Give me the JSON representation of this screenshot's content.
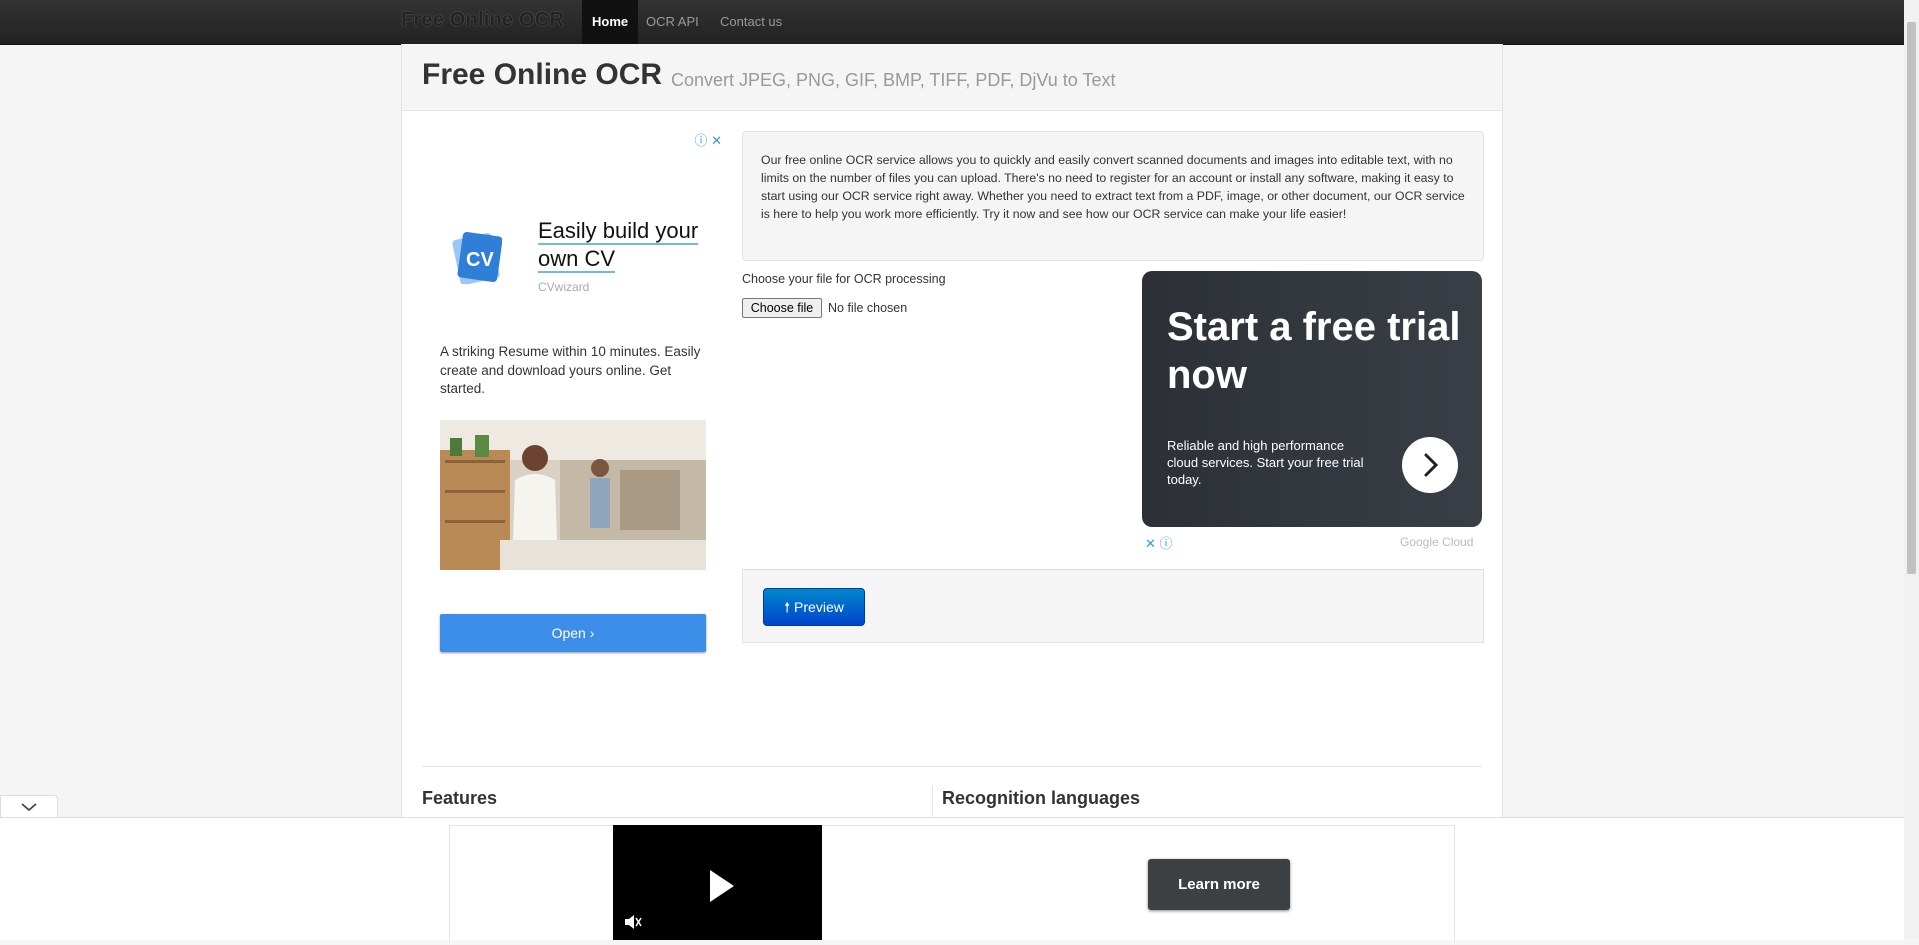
{
  "navbar": {
    "brand": "Free Online OCR",
    "items": [
      {
        "label": "Home",
        "active": true
      },
      {
        "label": "OCR API",
        "active": false
      },
      {
        "label": "Contact us",
        "active": false
      }
    ]
  },
  "header": {
    "title": "Free Online OCR",
    "subtitle": "Convert JPEG, PNG, GIF, BMP, TIFF, PDF, DjVu to Text"
  },
  "left_ad": {
    "headline": "Easily build your own CV",
    "brand": "CVwizard",
    "logo_text": "CV",
    "description": "A striking Resume within 10 minutes. Easily create and download yours online. Get started.",
    "cta": "Open"
  },
  "intro": {
    "text": "Our free online OCR service allows you to quickly and easily convert scanned documents and images into editable text, with no limits on the number of files you can upload. There's no need to register for an account or install any software, making it easy to start using our OCR service right away. Whether you need to extract text from a PDF, image, or other document, our OCR service is here to help you work more efficiently. Try it now and see how our OCR service can make your life easier!"
  },
  "upload": {
    "label": "Choose your file for OCR processing",
    "button": "Choose file",
    "status": "No file chosen"
  },
  "cloud_ad": {
    "headline": "Start a free trial now",
    "body": "Reliable and high performance cloud services. Start your free trial today.",
    "brand": "Google Cloud"
  },
  "preview": {
    "label": "Preview"
  },
  "sections": {
    "features": "Features",
    "languages": "Recognition languages"
  },
  "bottom_ad": {
    "cta": "Learn more"
  },
  "colors": {
    "navbar": "#222222",
    "primary_button": "#0055cc",
    "ad_blue": "#3d8ee8",
    "cloud_ad_bg": "#2f343a"
  }
}
